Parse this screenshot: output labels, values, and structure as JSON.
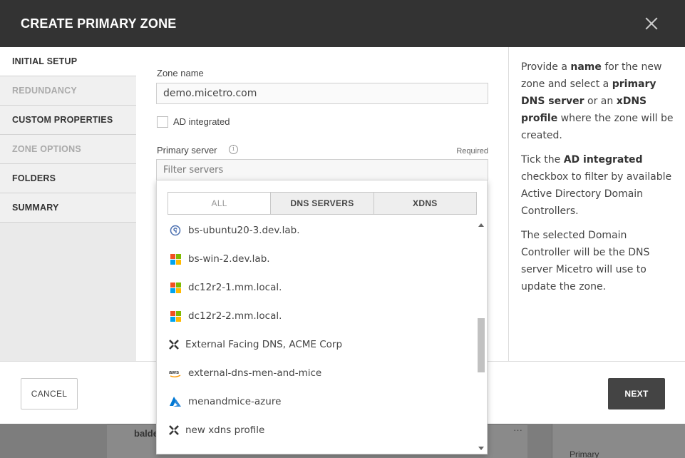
{
  "modal": {
    "title": "CREATE PRIMARY ZONE"
  },
  "nav": {
    "items": [
      {
        "label": "INITIAL SETUP",
        "state": "active"
      },
      {
        "label": "REDUNDANCY",
        "state": "disabled"
      },
      {
        "label": "CUSTOM PROPERTIES",
        "state": "normal"
      },
      {
        "label": "ZONE OPTIONS",
        "state": "disabled"
      },
      {
        "label": "FOLDERS",
        "state": "normal"
      },
      {
        "label": "SUMMARY",
        "state": "normal"
      }
    ]
  },
  "form": {
    "zone_name_label": "Zone name",
    "zone_name_value": "demo.micetro.com",
    "ad_integrated_label": "AD integrated",
    "ad_integrated_checked": false,
    "primary_server_label": "Primary server",
    "required_label": "Required",
    "filter_placeholder": "Filter servers"
  },
  "dropdown": {
    "tabs": [
      {
        "label": "ALL",
        "active": true
      },
      {
        "label": "DNS SERVERS",
        "active": false
      },
      {
        "label": "XDNS",
        "active": false
      }
    ],
    "servers": [
      {
        "label": "bs-ubuntu20-3.dev.lab.",
        "icon": "bind-icon"
      },
      {
        "label": "bs-win-2.dev.lab.",
        "icon": "windows-icon"
      },
      {
        "label": "dc12r2-1.mm.local.",
        "icon": "windows-icon"
      },
      {
        "label": "dc12r2-2.mm.local.",
        "icon": "windows-icon"
      },
      {
        "label": "External Facing DNS, ACME Corp",
        "icon": "xdns-icon"
      },
      {
        "label": "external-dns-men-and-mice",
        "icon": "aws-icon"
      },
      {
        "label": "menandmice-azure",
        "icon": "azure-icon"
      },
      {
        "label": "new xdns profile",
        "icon": "xdns-icon"
      }
    ]
  },
  "help": {
    "p1": [
      "Provide a ",
      "name",
      " for the new zone and select a ",
      "primary DNS server",
      " or an ",
      "xDNS profile",
      " where the zone will be created."
    ],
    "p2": [
      "Tick the ",
      "AD integrated",
      " checkbox to filter by available Active Directory Domain Controllers."
    ],
    "p3": "The selected Domain Controller will be the DNS server Micetro will use to update the zone."
  },
  "footer": {
    "cancel_label": "CANCEL",
    "next_label": "NEXT"
  },
  "background": {
    "row_text": "balde",
    "side_text": "Primary"
  },
  "colors": {
    "header_bg": "#333333",
    "next_bg": "#444444",
    "azure_blue": "#0078d4",
    "aws_orange": "#ff9900"
  }
}
